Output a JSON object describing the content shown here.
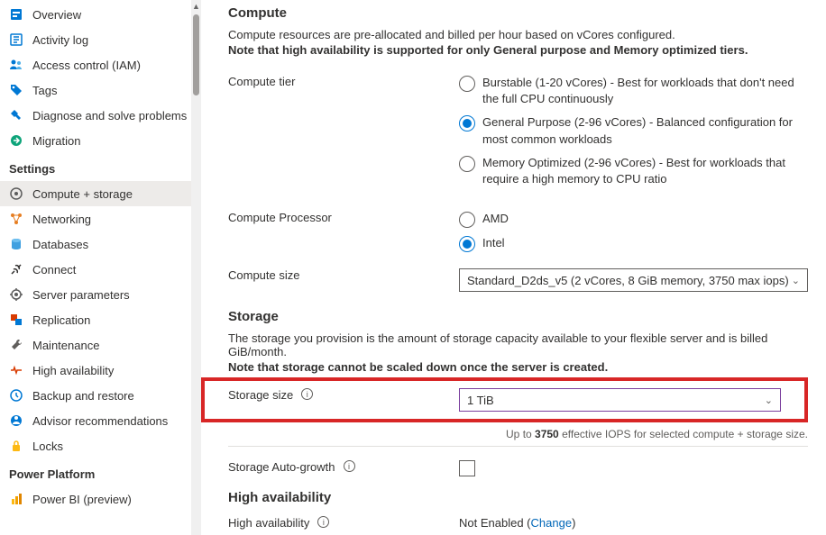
{
  "sidebar": {
    "top_items": [
      {
        "label": "Overview",
        "color": "#0078d4"
      },
      {
        "label": "Activity log",
        "color": "#0078d4"
      },
      {
        "label": "Access control (IAM)",
        "color": "#0078d4"
      },
      {
        "label": "Tags",
        "color": "#0078d4"
      },
      {
        "label": "Diagnose and solve problems",
        "color": "#0078d4"
      },
      {
        "label": "Migration",
        "color": "#0ea47a"
      }
    ],
    "settings_header": "Settings",
    "settings_items": [
      {
        "label": "Compute + storage",
        "selected": true
      },
      {
        "label": "Networking"
      },
      {
        "label": "Databases"
      },
      {
        "label": "Connect"
      },
      {
        "label": "Server parameters"
      },
      {
        "label": "Replication"
      },
      {
        "label": "Maintenance"
      },
      {
        "label": "High availability"
      },
      {
        "label": "Backup and restore"
      },
      {
        "label": "Advisor recommendations"
      },
      {
        "label": "Locks"
      }
    ],
    "pp_header": "Power Platform",
    "pp_items": [
      {
        "label": "Power BI (preview)"
      }
    ]
  },
  "compute": {
    "heading": "Compute",
    "desc": "Compute resources are pre-allocated and billed per hour based on vCores configured.",
    "note": "Note that high availability is supported for only General purpose and Memory optimized tiers.",
    "tier_label": "Compute tier",
    "tiers": [
      {
        "text": "Burstable (1-20 vCores) - Best for workloads that don't need the full CPU continuously"
      },
      {
        "text": "General Purpose (2-96 vCores) - Balanced configuration for most common workloads"
      },
      {
        "text": "Memory Optimized (2-96 vCores) - Best for workloads that require a high memory to CPU ratio"
      }
    ],
    "processor_label": "Compute Processor",
    "processors": [
      {
        "text": "AMD"
      },
      {
        "text": "Intel"
      }
    ],
    "size_label": "Compute size",
    "size_value": "Standard_D2ds_v5 (2 vCores, 8 GiB memory, 3750 max iops)"
  },
  "storage": {
    "heading": "Storage",
    "desc": "The storage you provision is the amount of storage capacity available to your flexible server and is billed GiB/month.",
    "note": "Note that storage cannot be scaled down once the server is created.",
    "size_label": "Storage size",
    "size_value": "1 TiB",
    "iops_prefix": "Up to ",
    "iops_val": "3750",
    "iops_suffix": " effective IOPS for selected compute + storage size.",
    "autogrowth_label": "Storage Auto-growth"
  },
  "ha": {
    "heading": "High availability",
    "label": "High availability",
    "value": "Not Enabled",
    "link": "Change"
  }
}
